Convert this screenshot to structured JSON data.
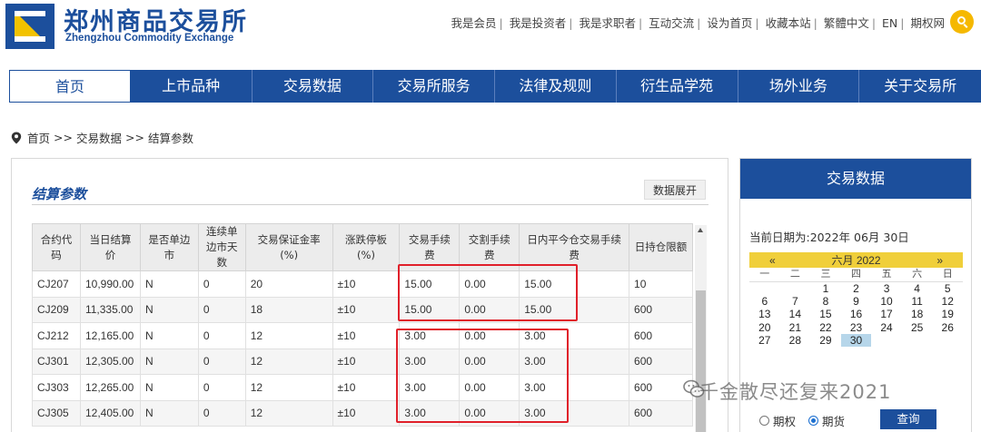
{
  "header": {
    "logo_cn": "郑州商品交易所",
    "logo_en": "Zhengzhou Commodity Exchange",
    "toplinks": [
      "我是会员",
      "我是投资者",
      "我是求职者",
      "互动交流",
      "设为首页",
      "收藏本站",
      "繁體中文",
      "EN",
      "期权网"
    ],
    "search_icon": "search-icon"
  },
  "nav": {
    "items": [
      "首页",
      "上市品种",
      "交易数据",
      "交易所服务",
      "法律及规则",
      "衍生品学苑",
      "场外业务",
      "关于交易所"
    ],
    "active": "首页"
  },
  "breadcrumb": {
    "home": "首页",
    "sep": ">>",
    "level1": "交易数据",
    "level2": "结算参数"
  },
  "main": {
    "title": "结算参数",
    "expand_label": "数据展开",
    "columns": [
      "合约代码",
      "当日结算价",
      "是否单边市",
      "连续单边市天数",
      "交易保证金率(%)",
      "涨跌停板(%)",
      "交易手续费",
      "交割手续费",
      "日内平今仓交易手续费",
      "日持仓限额"
    ],
    "rows": [
      [
        "CJ207",
        "10,990.00",
        "N",
        "0",
        "20",
        "±10",
        "15.00",
        "0.00",
        "15.00",
        "10"
      ],
      [
        "CJ209",
        "11,335.00",
        "N",
        "0",
        "18",
        "±10",
        "15.00",
        "0.00",
        "15.00",
        "600"
      ],
      [
        "CJ212",
        "12,165.00",
        "N",
        "0",
        "12",
        "±10",
        "3.00",
        "0.00",
        "3.00",
        "600"
      ],
      [
        "CJ301",
        "12,305.00",
        "N",
        "0",
        "12",
        "±10",
        "3.00",
        "0.00",
        "3.00",
        "600"
      ],
      [
        "CJ303",
        "12,265.00",
        "N",
        "0",
        "12",
        "±10",
        "3.00",
        "0.00",
        "3.00",
        "600"
      ],
      [
        "CJ305",
        "12,405.00",
        "N",
        "0",
        "12",
        "±10",
        "3.00",
        "0.00",
        "3.00",
        "600"
      ]
    ],
    "highlight_color": "#e0202a"
  },
  "sidebar": {
    "title": "交易数据",
    "current_date_label": "当前日期为:",
    "current_date": "2022年 06月 30日",
    "calendar": {
      "prev": "«",
      "month_label": "六月 2022",
      "next": "»",
      "weekdays": [
        "一",
        "二",
        "三",
        "四",
        "五",
        "六",
        "日"
      ],
      "leading_blanks": 2,
      "days": [
        "1",
        "2",
        "3",
        "4",
        "5",
        "6",
        "7",
        "8",
        "9",
        "10",
        "11",
        "12",
        "13",
        "14",
        "15",
        "16",
        "17",
        "18",
        "19",
        "20",
        "21",
        "22",
        "23",
        "24",
        "25",
        "26",
        "27",
        "28",
        "29",
        "30"
      ],
      "selected_day": "30"
    },
    "radio_options": [
      "期权",
      "期货"
    ],
    "radio_selected": "期货",
    "query_label": "查询"
  },
  "watermark": {
    "text": "千金散尽还复来2021"
  },
  "colors": {
    "brand_blue": "#1c4f9c",
    "accent_yellow": "#f5b800",
    "calendar_header": "#f0cf3a"
  }
}
